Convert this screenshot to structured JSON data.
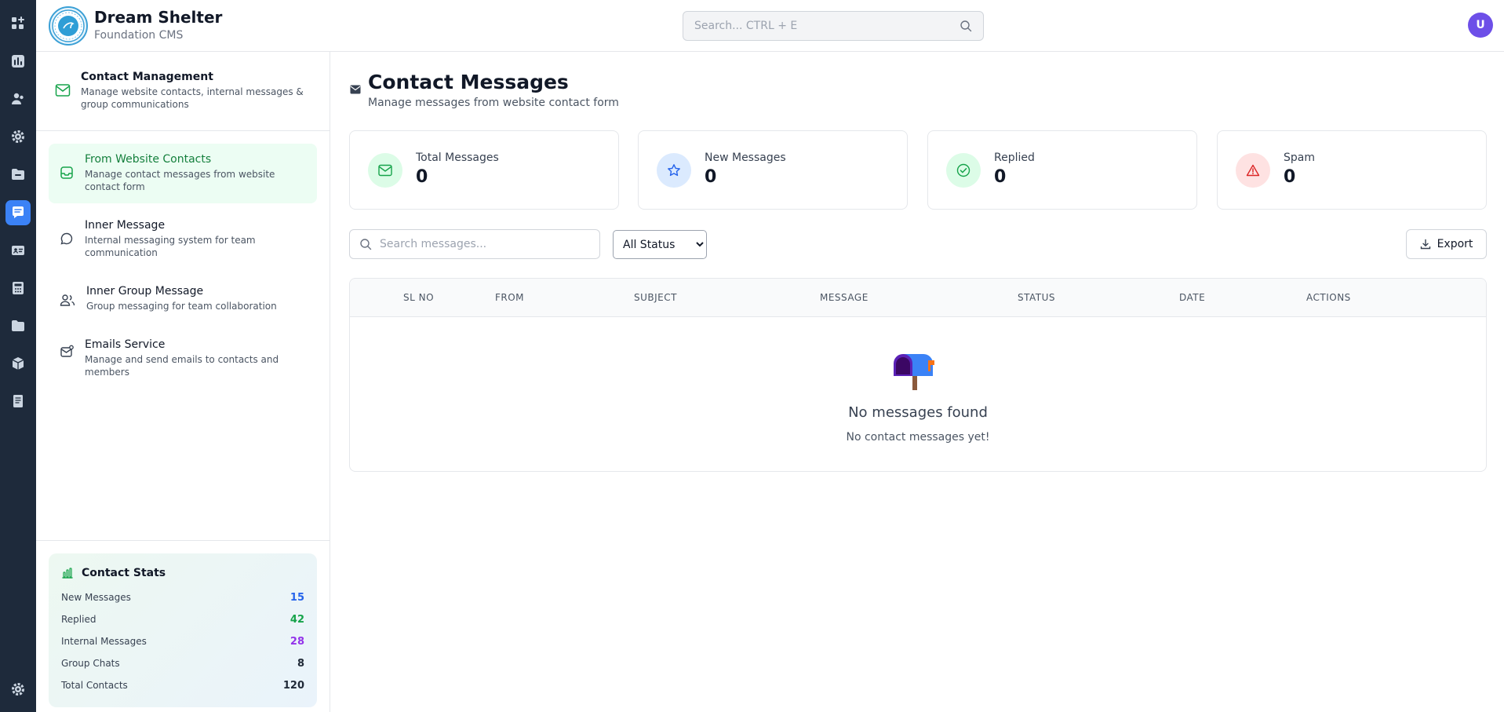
{
  "header": {
    "brand_title": "Dream Shelter",
    "brand_subtitle": "Foundation CMS",
    "search_placeholder": "Search... CTRL + E",
    "avatar_initial": "U"
  },
  "rail": {
    "icons": [
      "apps-icon",
      "chart-icon",
      "users-icon",
      "gear-icon",
      "inbox-folder-icon",
      "chat-icon",
      "id-card-icon",
      "calculator-icon",
      "folder-icon",
      "box-icon",
      "book-icon",
      "settings-icon"
    ],
    "active": "chat-icon"
  },
  "sidebar": {
    "title": "Contact Management",
    "description": "Manage website contacts, internal messages & group communications",
    "items": [
      {
        "label": "From Website Contacts",
        "description": "Manage contact messages from website contact form",
        "icon": "inbox-icon",
        "active": true
      },
      {
        "label": "Inner Message",
        "description": "Internal messaging system for team communication",
        "icon": "chat-bubble-icon",
        "active": false
      },
      {
        "label": "Inner Group Message",
        "description": "Group messaging for team collaboration",
        "icon": "users-icon",
        "active": false
      },
      {
        "label": "Emails Service",
        "description": "Manage and send emails to contacts and members",
        "icon": "mail-notify-icon",
        "active": false
      }
    ],
    "stats": {
      "title": "Contact Stats",
      "rows": [
        {
          "label": "New Messages",
          "value": "15",
          "color": "#2563eb"
        },
        {
          "label": "Replied",
          "value": "42",
          "color": "#16a34a"
        },
        {
          "label": "Internal Messages",
          "value": "28",
          "color": "#9333ea"
        },
        {
          "label": "Group Chats",
          "value": "8",
          "color": "#1f2937"
        },
        {
          "label": "Total Contacts",
          "value": "120",
          "color": "#1f2937"
        }
      ]
    }
  },
  "main": {
    "title": "Contact Messages",
    "subtitle": "Manage messages from website contact form",
    "cards": [
      {
        "label": "Total Messages",
        "value": "0",
        "icon": "mail-icon",
        "color": "#16a34a",
        "bg": "#dcfce7"
      },
      {
        "label": "New Messages",
        "value": "0",
        "icon": "star-icon",
        "color": "#2563eb",
        "bg": "#dbeafe"
      },
      {
        "label": "Replied",
        "value": "0",
        "icon": "check-circle-icon",
        "color": "#16a34a",
        "bg": "#dcfce7"
      },
      {
        "label": "Spam",
        "value": "0",
        "icon": "warning-icon",
        "color": "#dc2626",
        "bg": "#fee2e2"
      }
    ],
    "search_placeholder": "Search messages...",
    "status_filter": {
      "selected": "All Status",
      "options": [
        "All Status"
      ]
    },
    "export_label": "Export",
    "table": {
      "columns": [
        "SL NO",
        "FROM",
        "SUBJECT",
        "MESSAGE",
        "STATUS",
        "DATE",
        "ACTIONS"
      ],
      "rows": [],
      "empty_title": "No messages found",
      "empty_subtitle": "No contact messages yet!"
    }
  }
}
